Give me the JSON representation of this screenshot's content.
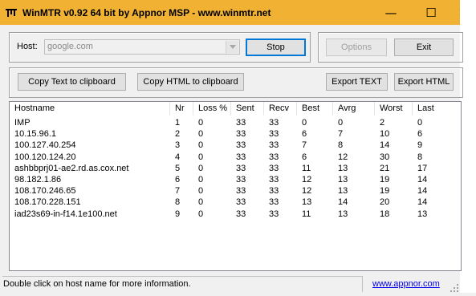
{
  "window": {
    "title": "WinMTR v0.92 64 bit by Appnor MSP - www.winmtr.net",
    "controls": {
      "minimize": "—",
      "maximize": "☐",
      "close": "✕"
    },
    "title_bar_color": "#f1b133"
  },
  "host": {
    "label": "Host:",
    "value": "google.com"
  },
  "buttons": {
    "stop": "Stop",
    "options": "Options",
    "exit": "Exit",
    "copy_text": "Copy Text to clipboard",
    "copy_html": "Copy HTML to clipboard",
    "export_text": "Export TEXT",
    "export_html": "Export HTML"
  },
  "table": {
    "columns": [
      "Hostname",
      "Nr",
      "Loss %",
      "Sent",
      "Recv",
      "Best",
      "Avrg",
      "Worst",
      "Last"
    ],
    "rows": [
      [
        "IMP",
        "1",
        "0",
        "33",
        "33",
        "0",
        "0",
        "2",
        "0"
      ],
      [
        "10.15.96.1",
        "2",
        "0",
        "33",
        "33",
        "6",
        "7",
        "10",
        "6"
      ],
      [
        "100.127.40.254",
        "3",
        "0",
        "33",
        "33",
        "7",
        "8",
        "14",
        "9"
      ],
      [
        "100.120.124.20",
        "4",
        "0",
        "33",
        "33",
        "6",
        "12",
        "30",
        "8"
      ],
      [
        "ashbbprj01-ae2.rd.as.cox.net",
        "5",
        "0",
        "33",
        "33",
        "11",
        "13",
        "21",
        "17"
      ],
      [
        "98.182.1.86",
        "6",
        "0",
        "33",
        "33",
        "12",
        "13",
        "19",
        "14"
      ],
      [
        "108.170.246.65",
        "7",
        "0",
        "33",
        "33",
        "12",
        "13",
        "19",
        "14"
      ],
      [
        "108.170.228.151",
        "8",
        "0",
        "33",
        "33",
        "13",
        "14",
        "20",
        "14"
      ],
      [
        "iad23s69-in-f14.1e100.net",
        "9",
        "0",
        "33",
        "33",
        "11",
        "13",
        "18",
        "13"
      ]
    ]
  },
  "status": {
    "message": "Double click on host name for more information.",
    "link": "www.appnor.com"
  }
}
